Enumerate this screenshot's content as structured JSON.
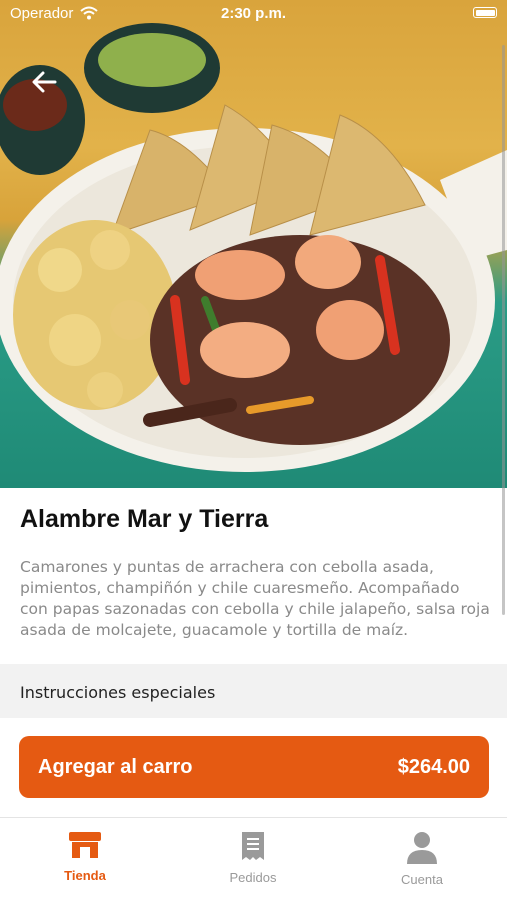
{
  "status_bar": {
    "carrier": "Operador",
    "time": "2:30 p.m."
  },
  "product": {
    "title": "Alambre Mar y Tierra",
    "description": "Camarones y puntas de arrachera con cebolla asada, pimientos, champiñón y chile cuaresmeño. Acompañado con papas sazonadas con cebolla y chile jalapeño, salsa roja asada de molcajete, guacamole y tortilla de maíz."
  },
  "special_instructions": {
    "label": "Instrucciones especiales"
  },
  "add_to_cart": {
    "label": "Agregar al carro",
    "price": "$264.00"
  },
  "tabs": [
    {
      "label": "Tienda",
      "icon": "store-icon",
      "active": true
    },
    {
      "label": "Pedidos",
      "icon": "receipt-icon",
      "active": false
    },
    {
      "label": "Cuenta",
      "icon": "user-icon",
      "active": false
    }
  ],
  "colors": {
    "accent": "#e55a12",
    "inactive_tab": "#9a9a9a"
  }
}
